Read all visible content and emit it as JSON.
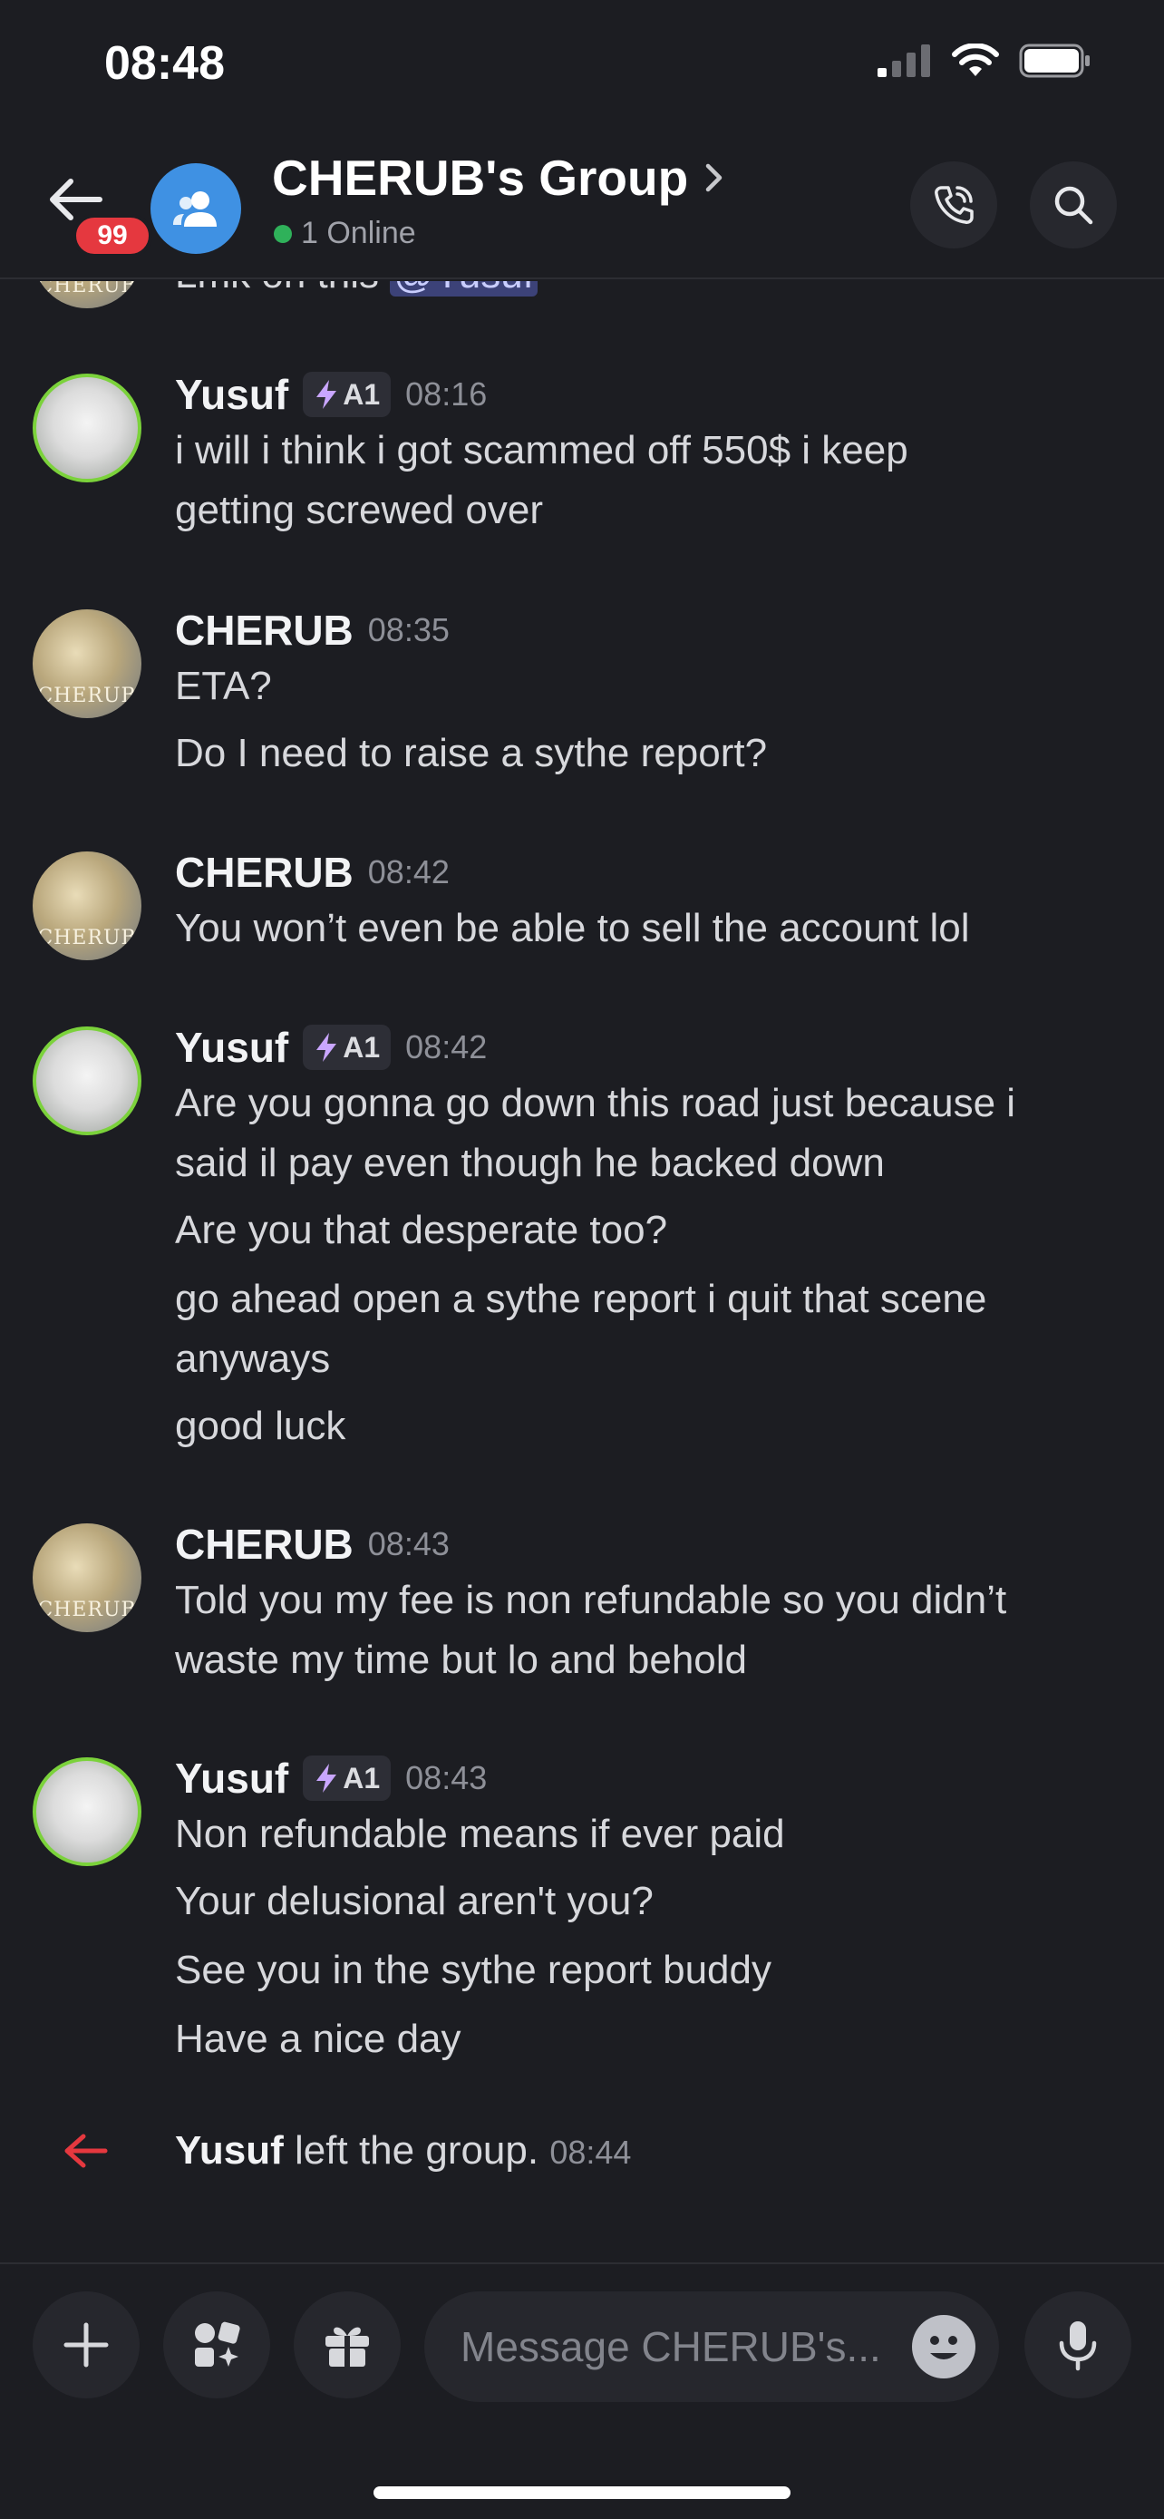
{
  "status_bar": {
    "time": "08:48"
  },
  "header": {
    "back_badge": "99",
    "title": "CHERUB's Group",
    "online_text": "1 Online"
  },
  "partial_message": {
    "text": "Lmk on this",
    "mention": "@Yusuf",
    "avatar_label": "CHERUB"
  },
  "messages": [
    {
      "author": "Yusuf",
      "tag": "A1",
      "time": "08:16",
      "lines": [
        "i will i think i got scammed off 550$ i keep",
        "getting screwed over"
      ]
    },
    {
      "author": "CHERUB",
      "time": "08:35",
      "lines": [
        "ETA?",
        "Do I need to raise a sythe report?"
      ]
    },
    {
      "author": "CHERUB",
      "time": "08:42",
      "lines": [
        "You won’t even be able to sell the account lol"
      ]
    },
    {
      "author": "Yusuf",
      "tag": "A1",
      "time": "08:42",
      "lines": [
        "Are you gonna go down this road just because i",
        "said il pay even though he backed down",
        "Are you that desperate too?",
        "go ahead open a sythe report i quit that scene",
        "anyways",
        "good luck"
      ]
    },
    {
      "author": "CHERUB",
      "time": "08:43",
      "lines": [
        "Told you my fee is non refundable so you didn’t",
        "waste my time but lo and behold"
      ]
    },
    {
      "author": "Yusuf",
      "tag": "A1",
      "time": "08:43",
      "lines": [
        "Non refundable means if ever paid",
        "Your delusional aren't you?",
        "See you in the sythe report buddy",
        "Have a nice day"
      ]
    }
  ],
  "system_message": {
    "user": "Yusuf",
    "text": "left the group.",
    "time": "08:44"
  },
  "composer": {
    "placeholder": "Message CHERUB's..."
  },
  "colors": {
    "background": "#1c1d22",
    "accent": "#3f91e3",
    "badge": "#e5383f",
    "online": "#2fb15a",
    "leave_arrow": "#e5383f"
  }
}
